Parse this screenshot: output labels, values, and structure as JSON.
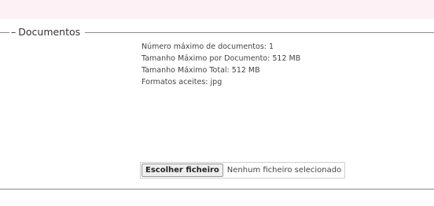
{
  "fieldset": {
    "legend_dash": "–",
    "legend": "Documentos"
  },
  "info": {
    "max_docs": "Número máximo de documentos: 1",
    "max_size_per_doc": "Tamanho Máximo por Documento: 512 MB",
    "max_total_size": "Tamanho Máximo Total: 512 MB",
    "formats": "Formatos aceites: jpg"
  },
  "file_input": {
    "button_label": "Escolher ficheiro",
    "status": "Nenhum ficheiro selecionado"
  }
}
